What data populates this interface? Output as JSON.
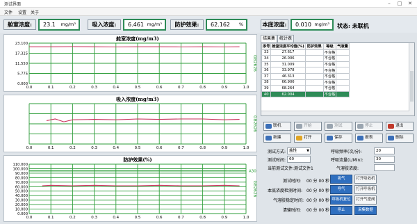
{
  "window": {
    "title": "测试界面",
    "controls": [
      "–",
      "□",
      "✕"
    ]
  },
  "menu": [
    "文件",
    "设置",
    "关于"
  ],
  "readings": [
    {
      "label": "舱室浓度:",
      "value": "23.1",
      "unit": "mg/m³"
    },
    {
      "label": "吸入浓度:",
      "value": "6.461",
      "unit": "mg/m³"
    },
    {
      "label": "防护效果:",
      "value": "62.162",
      "unit": "%"
    },
    {
      "label": "本底浓度:",
      "value": "0.010",
      "unit": "mg/m³"
    }
  ],
  "status": "状态: 未联机",
  "charts": {
    "cabin": {
      "title": "舱室浓度(mg/m3)",
      "side_label": "GB2626",
      "y_ticks": [
        "23.100",
        "17.325",
        "11.550",
        "5.775",
        "0.000"
      ],
      "x_ticks": [
        "0.0",
        "0.1",
        "0.2",
        "0.3",
        "0.4",
        "0.5",
        "0.6",
        "0.7",
        "0.8",
        "0.9",
        "1.0"
      ]
    },
    "inhale": {
      "title": "吸入浓度(mg/m3)",
      "side_label": "GB2626",
      "x_ticks": [
        "0.0",
        "0.1",
        "0.2",
        "0.3",
        "0.4",
        "0.5",
        "0.6",
        "0.7",
        "0.8",
        "0.9",
        "1.0"
      ]
    },
    "protect": {
      "title": "防护效果(%)",
      "side_label": "GB2626",
      "marker": "A30",
      "y_ticks": [
        "110.000",
        "100.000",
        "90.000",
        "80.000",
        "70.000",
        "60.000",
        "50.000",
        "40.000",
        "30.000",
        "20.000",
        "10.000",
        "0.000"
      ],
      "x_ticks": [
        "0.0",
        "0.1",
        "0.2",
        "0.3",
        "0.4",
        "0.5",
        "0.6",
        "0.7",
        "0.8",
        "0.9",
        "1.0"
      ]
    }
  },
  "chart_data": [
    {
      "type": "line",
      "title": "舱室浓度(mg/m3)",
      "ylim": [
        0,
        23.1
      ],
      "xlim": [
        0,
        1
      ],
      "series": [
        {
          "x": [
            0.0,
            0.1,
            0.2,
            0.3,
            0.4,
            0.5,
            0.6,
            0.7,
            0.8,
            0.9,
            0.97
          ],
          "y": [
            21.0,
            21.0,
            21.1,
            21.0,
            20.9,
            21.0,
            21.0,
            20.9,
            21.0,
            20.9,
            21.0
          ]
        }
      ]
    },
    {
      "type": "line",
      "title": "吸入浓度(mg/m3)",
      "xlim": [
        0,
        1
      ],
      "series": [
        {
          "x": [
            0.08,
            0.12,
            0.16,
            0.2,
            0.3,
            0.4,
            0.5,
            0.6,
            0.7,
            0.8,
            0.9,
            0.97
          ],
          "y": [
            0.58,
            0.62,
            0.55,
            0.6,
            0.61,
            0.6,
            0.62,
            0.61,
            0.62,
            0.62,
            0.6,
            0.61
          ]
        }
      ]
    },
    {
      "type": "line",
      "title": "防护效果(%)",
      "ylim": [
        0,
        110
      ],
      "xlim": [
        0,
        1
      ],
      "series": [
        {
          "x": [
            0.06,
            0.1,
            0.2,
            0.3,
            0.4,
            0.5,
            0.6,
            0.7,
            0.8,
            0.9,
            0.97
          ],
          "y": [
            62,
            63,
            62,
            63,
            62,
            62,
            63,
            62,
            62,
            63,
            62
          ]
        },
        {
          "x": [
            0.0,
            1.0
          ],
          "y": [
            95,
            95
          ]
        }
      ]
    }
  ],
  "tabs": [
    "结果集",
    "统计表"
  ],
  "table": {
    "headers": [
      "序号",
      "舱室浓度平均值(%)",
      "防护效果",
      "等级",
      "气液量"
    ],
    "rows": [
      [
        "33",
        "27.617",
        "",
        "不合格",
        ""
      ],
      [
        "34",
        "26.006",
        "",
        "不合格",
        ""
      ],
      [
        "35",
        "31.009",
        "",
        "不合格",
        ""
      ],
      [
        "36",
        "33.978",
        "",
        "不合格",
        ""
      ],
      [
        "37",
        "46.313",
        "",
        "不合格",
        ""
      ],
      [
        "38",
        "66.906",
        "",
        "不合格",
        ""
      ],
      [
        "39",
        "68.264",
        "",
        "不合格",
        ""
      ],
      [
        "40",
        "62.004",
        "",
        "不合格",
        ""
      ]
    ],
    "selected_row": 7
  },
  "toolbar": [
    {
      "label": "联机",
      "color": "#3b6fb8",
      "dim": false
    },
    {
      "label": "开始",
      "color": "#9aa5b0",
      "dim": true
    },
    {
      "label": "测试",
      "color": "#9aa5b0",
      "dim": true
    },
    {
      "label": "停止",
      "color": "#9aa5b0",
      "dim": true
    },
    {
      "label": "退出",
      "color": "#c0392b",
      "dim": false
    },
    {
      "label": "新建",
      "color": "#3b6fb8",
      "dim": false
    },
    {
      "label": "打开",
      "color": "#e0a526",
      "dim": false
    },
    {
      "label": "保存",
      "color": "#3b6fb8",
      "dim": false
    },
    {
      "label": "报表",
      "color": "#3b6fb8",
      "dim": false
    },
    {
      "label": "删除",
      "color": "#3b6fb8",
      "dim": false
    }
  ],
  "form": {
    "method_label": "测试方式:",
    "method_value": "盐性",
    "time_label": "测试时间:",
    "time_value": "60",
    "file_label": "当前测试文件:测试文件1",
    "breath_rate_label": "呼吸频率(次/分):",
    "breath_rate_value": "20",
    "breath_flow_label": "呼吸流量(L/Min):",
    "breath_flow_value": "30",
    "aerosol_label": "气溶胶浓度:",
    "aerosol_value": ""
  },
  "timers": [
    {
      "label": "测试时间:",
      "value": "00 分 00 秒"
    },
    {
      "label": "本底浓度检测时间:",
      "value": "00 分 00 秒"
    },
    {
      "label": "气溶胶稳定时间:",
      "value": "00 分 00 秒"
    },
    {
      "label": "清输时间:",
      "value": "00 分 00 秒"
    }
  ],
  "controls": [
    {
      "label": "吸气",
      "style": "blue"
    },
    {
      "label": "打开吸收机",
      "style": "plain"
    },
    {
      "label": "呼气",
      "style": "blue"
    },
    {
      "label": "打开呼吸机",
      "style": "plain"
    },
    {
      "label": "呼吸机复位",
      "style": "blue"
    },
    {
      "label": "打开气密阀",
      "style": "plain"
    },
    {
      "label": "停止",
      "style": "blue"
    },
    {
      "label": "采集数据",
      "style": "blue"
    }
  ]
}
